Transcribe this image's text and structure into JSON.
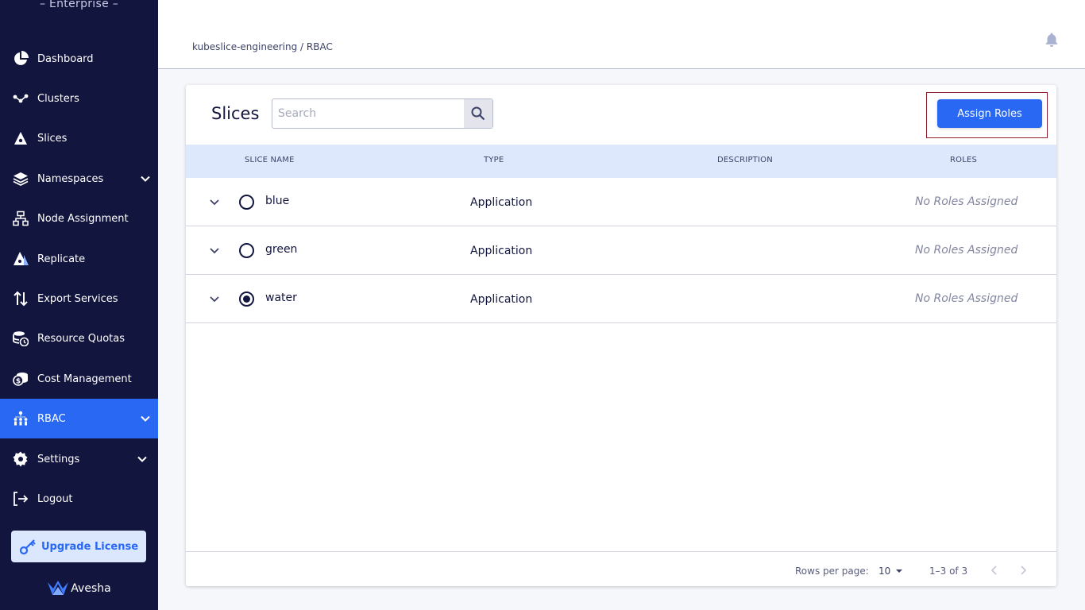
{
  "sidebar": {
    "brand_subtitle": "– Enterprise –",
    "items": [
      {
        "label": "Dashboard",
        "icon": "pie-chart-icon"
      },
      {
        "label": "Clusters",
        "icon": "nodes-icon"
      },
      {
        "label": "Slices",
        "icon": "slice-icon"
      },
      {
        "label": "Namespaces",
        "icon": "layers-icon"
      },
      {
        "label": "Node Assignment",
        "icon": "hierarchy-icon"
      },
      {
        "label": "Replicate",
        "icon": "replicate-icon"
      },
      {
        "label": "Export Services",
        "icon": "arrows-up-down-icon"
      },
      {
        "label": "Resource Quotas",
        "icon": "database-clock-icon"
      },
      {
        "label": "Cost Management",
        "icon": "coins-icon"
      },
      {
        "label": "RBAC",
        "icon": "people-network-icon"
      },
      {
        "label": "Settings",
        "icon": "gear-icon"
      },
      {
        "label": "Logout",
        "icon": "logout-icon"
      }
    ],
    "upgrade_label": "Upgrade License",
    "logo_text": "Avesha"
  },
  "header": {
    "breadcrumb": "kubeslice-engineering / RBAC"
  },
  "main": {
    "title": "Slices",
    "search_placeholder": "Search",
    "assign_roles_label": "Assign Roles",
    "columns": [
      "SLICE NAME",
      "TYPE",
      "DESCRIPTION",
      "ROLES"
    ],
    "rows": [
      {
        "name": "blue",
        "type": "Application",
        "description": "",
        "roles": "No Roles Assigned",
        "selected": false
      },
      {
        "name": "green",
        "type": "Application",
        "description": "",
        "roles": "No Roles Assigned",
        "selected": false
      },
      {
        "name": "water",
        "type": "Application",
        "description": "",
        "roles": "No Roles Assigned",
        "selected": true
      }
    ],
    "footer": {
      "rows_per_page_label": "Rows per page:",
      "rows_per_page_value": "10",
      "range": "1–3 of 3"
    }
  },
  "colors": {
    "sidebar_bg": "#12153e",
    "accent": "#2868f3",
    "table_header_bg": "#dde8fc"
  }
}
